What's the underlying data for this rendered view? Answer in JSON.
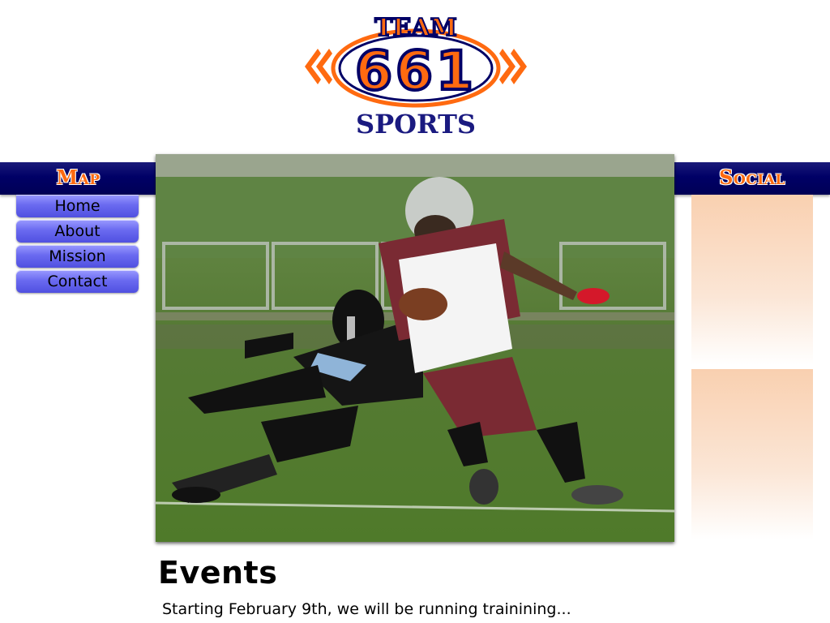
{
  "logo": {
    "line1": "TEAM",
    "line2": "661",
    "line3": "SPORTS"
  },
  "sidebar": {
    "title": "Map",
    "items": [
      {
        "label": "Home"
      },
      {
        "label": "About"
      },
      {
        "label": "Mission"
      },
      {
        "label": "Contact"
      }
    ]
  },
  "social": {
    "title": "Social"
  },
  "events": {
    "title": "Events",
    "text": "Starting February 9th, we will be running trainining..."
  },
  "colors": {
    "navy": "#000066",
    "orange": "#ff6a10",
    "button": "#6a6af0",
    "social_panel": "#f9d0b0"
  },
  "icons": {
    "hero": "football-players-photo",
    "logo": "team-661-sports-logo"
  }
}
